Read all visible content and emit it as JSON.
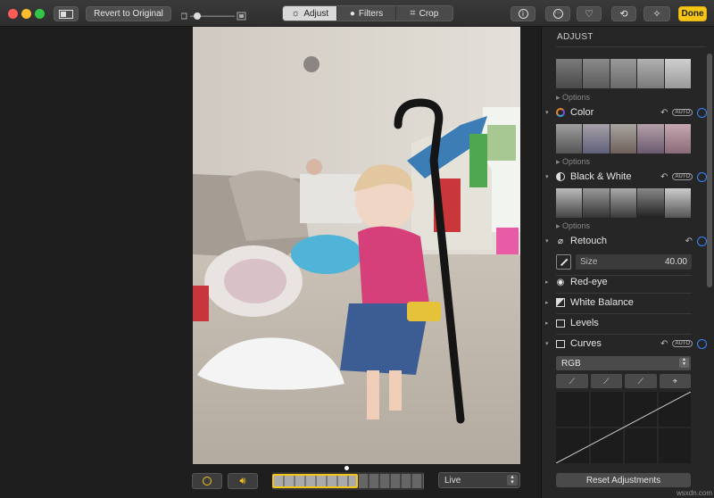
{
  "toolbar": {
    "revert_label": "Revert to Original",
    "tabs": [
      {
        "label": "Adjust",
        "icon": "sun-dial-icon"
      },
      {
        "label": "Filters",
        "icon": "circles-icon"
      },
      {
        "label": "Crop",
        "icon": "crop-icon"
      }
    ],
    "active_tab": "Adjust",
    "done_label": "Done",
    "accent": "#f5c518"
  },
  "bottom": {
    "live_label": "Live"
  },
  "panel": {
    "title": "ADJUST",
    "options_label": "Options",
    "sections": {
      "color": "Color",
      "bw": "Black & White",
      "retouch": "Retouch",
      "size_label": "Size",
      "size_value": "40.00",
      "redeye": "Red-eye",
      "white_balance": "White Balance",
      "levels": "Levels",
      "curves": "Curves",
      "channel": "RGB",
      "auto": "AUTO"
    },
    "reset_label": "Reset Adjustments"
  },
  "watermark": "wsxdn.com"
}
